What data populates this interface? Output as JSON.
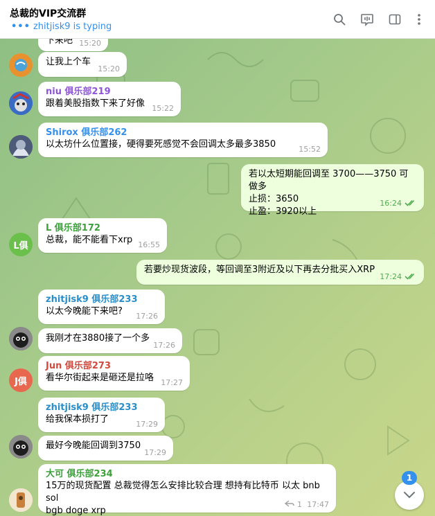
{
  "header": {
    "title": "总裁的VIP交流群",
    "typing": "zhitjisk9 is typing",
    "icons": [
      "search-icon",
      "live-stream-icon",
      "sidebar-icon",
      "more-icon"
    ]
  },
  "messages": [
    {
      "id": 0,
      "text": "下来吧",
      "time": "15:20"
    },
    {
      "id": 1,
      "text": "让我上个车",
      "time": "15:20"
    },
    {
      "id": 2,
      "sender": "niu 俱乐部219",
      "sender_color": "#8e55d6",
      "text": "跟着美股指数下来了好像",
      "time": "15:22"
    },
    {
      "id": 3,
      "sender": "Shirox 俱乐部262",
      "sender_color": "#3390ec",
      "text": "以太坊什么位置接，硬得要死感觉不会回调太多最多3850",
      "time": "15:52"
    },
    {
      "id": 4,
      "outgoing": true,
      "text": "若以太短期能回调至 3700——3750 可做多\n止损：3650\n止盈：3920以上",
      "time": "16:24"
    },
    {
      "id": 5,
      "sender": "L 俱乐部172",
      "sender_color": "#3ca13a",
      "avatar_text": "L俱",
      "text": "总裁，能不能看下xrp",
      "time": "16:55"
    },
    {
      "id": 6,
      "outgoing": true,
      "text": "若要炒现货波段，等回调至3附近及以下再去分批买入XRP",
      "time": "17:24"
    },
    {
      "id": 7,
      "sender": "zhitjisk9 俱乐部233",
      "sender_color": "#2a8ec9",
      "text": "以太今晚能下来吧?",
      "time": "17:26"
    },
    {
      "id": 8,
      "text": "我刚才在3880接了一个多",
      "time": "17:26"
    },
    {
      "id": 9,
      "sender": "Jun 俱乐部273",
      "sender_color": "#cf4a3f",
      "avatar_text": "J俱",
      "text": "看华尔街起来是砸还是拉咯",
      "time": "17:27"
    },
    {
      "id": 10,
      "sender": "zhitjisk9 俱乐部233",
      "sender_color": "#2a8ec9",
      "text": "给我保本损打了",
      "time": "17:29"
    },
    {
      "id": 11,
      "text": "最好今晚能回调到3750",
      "time": "17:29"
    },
    {
      "id": 12,
      "sender": "大可 俱乐部234",
      "sender_color": "#3ca13a",
      "text": "15万的现货配置 总裁觉得怎么安排比较合理 想持有比特币 以太 bnb sol\nbgb doge xrp",
      "time": "17:47",
      "replies": "1"
    }
  ],
  "scroll": {
    "unread_count": "1"
  },
  "colors": {
    "accent": "#3390ec",
    "outgoing_bubble": "#eeffde",
    "check": "#4fae4e"
  }
}
